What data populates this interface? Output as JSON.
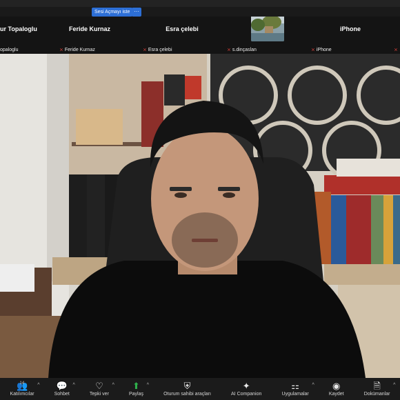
{
  "topbar": {
    "unmute_label": "Sesi Açmayı iste",
    "more_label": "···"
  },
  "participants": [
    {
      "name": "ur Topaloglu",
      "label": "opaloglu",
      "muted": false
    },
    {
      "name": "Feride Kurnaz",
      "label": "Feride Kurnaz",
      "muted": true
    },
    {
      "name": "Esra çelebi",
      "label": "Esra çelebi",
      "muted": true
    },
    {
      "name": "",
      "label": "s.dinçaslan",
      "muted": true
    },
    {
      "name": "iPhone",
      "label": "iPhone",
      "muted": true
    }
  ],
  "toolbar": {
    "participants_count": "14",
    "items": [
      {
        "label": "Katılımcılar",
        "icon": "participants-icon"
      },
      {
        "label": "Sohbet",
        "icon": "chat-icon"
      },
      {
        "label": "Tepki ver",
        "icon": "heart-icon"
      },
      {
        "label": "Paylaş",
        "icon": "share-icon"
      },
      {
        "label": "Oturum sahibi araçları",
        "icon": "shield-icon"
      },
      {
        "label": "AI Companion",
        "icon": "sparkle-icon"
      },
      {
        "label": "Uygulamalar",
        "icon": "apps-icon"
      },
      {
        "label": "Kaydet",
        "icon": "record-icon"
      },
      {
        "label": "Dokümanlar",
        "icon": "docs-icon"
      }
    ]
  },
  "colors": {
    "accent": "#2d6fd6",
    "share_green": "#2fb24c",
    "muted_red": "#e0413a"
  }
}
